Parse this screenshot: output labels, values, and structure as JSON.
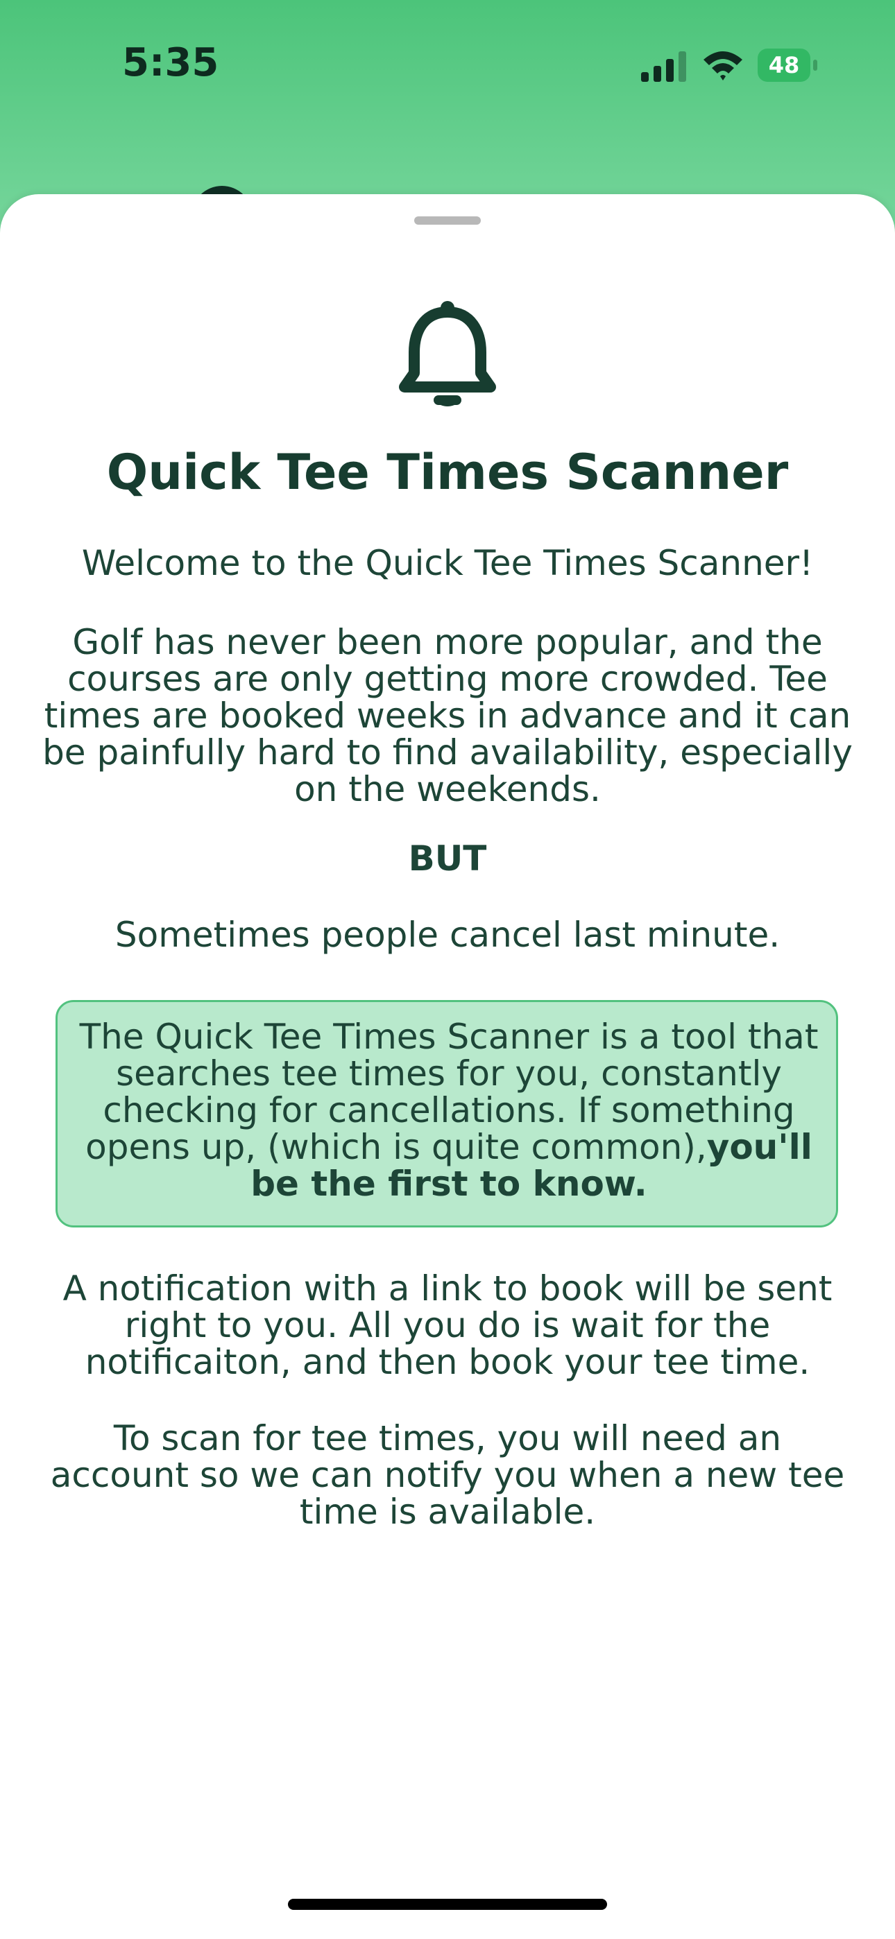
{
  "status_bar": {
    "time": "5:35",
    "battery_level": "48",
    "icons": [
      "signal-icon",
      "wifi-icon",
      "battery-icon"
    ]
  },
  "sheet": {
    "icon": "bell-icon",
    "title": "Quick Tee Times Scanner",
    "welcome": "Welcome to the Quick Tee Times Scanner!",
    "golf_paragraph": "Golf has never been more popular, and the courses are only getting more crowded. Tee times are booked weeks in advance and it can be painfully hard to find availability, especially on the weekends.",
    "but": "BUT",
    "cancel_paragraph": "Sometimes people cancel last minute.",
    "highlight": {
      "text": "The Quick Tee Times Scanner is a tool that searches tee times for you, constantly checking for cancellations. If something opens up, (which is quite common),",
      "bold_text": "you'll be the first to know."
    },
    "notification_paragraph": "A notification with a link to book will be sent right to you. All you do is wait for the notificaiton, and then book your tee time.",
    "account_paragraph": "To scan for tee times, you will need an account so we can notify you when a new tee time is available."
  },
  "colors": {
    "header_gradient_top": "#4cc47a",
    "header_gradient_bottom": "#9fe0bb",
    "text_dark_green": "#1d4537",
    "highlight_bg": "#b8e9cc",
    "highlight_border": "#52c27f",
    "battery_green": "#32b864"
  }
}
